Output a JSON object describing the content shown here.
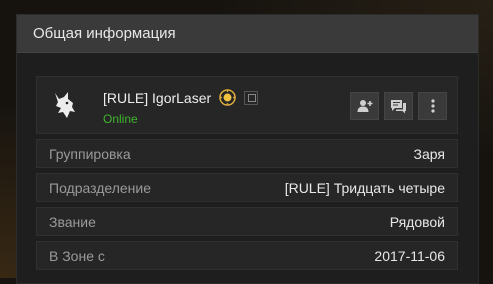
{
  "panel": {
    "title": "Общая информация"
  },
  "profile": {
    "name": "[RULE] IgorLaser",
    "status": "Online",
    "status_color": "#3fb42e",
    "avatar_icon": "wolf-icon",
    "badge_icon": "rank-badge-icon",
    "copy_icon": "copy-icon",
    "actions": [
      {
        "icon": "add-friend-icon"
      },
      {
        "icon": "message-icon"
      },
      {
        "icon": "more-icon"
      }
    ]
  },
  "info_rows": [
    {
      "label": "Группировка",
      "value": "Заря"
    },
    {
      "label": "Подразделение",
      "value": "[RULE] Тридцать четыре"
    },
    {
      "label": "Звание",
      "value": "Рядовой"
    },
    {
      "label": "В Зоне с",
      "value": "2017-11-06"
    }
  ]
}
